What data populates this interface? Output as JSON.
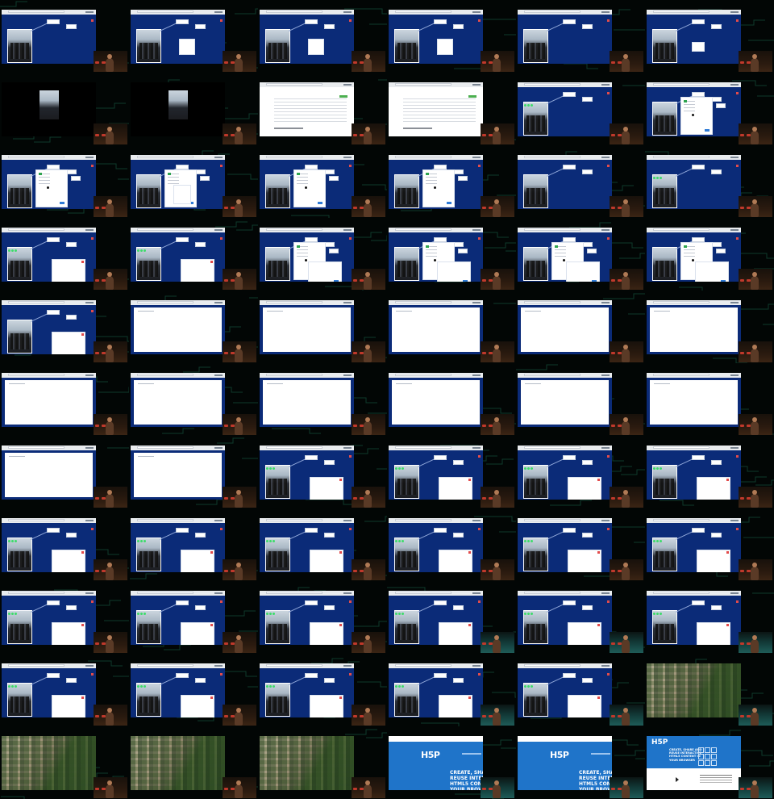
{
  "grid": {
    "title": "",
    "rows": [
      [
        "editor-label",
        "editor-label-popup",
        "editor-label-popup",
        "editor-label-popup",
        "editor-labels",
        "editor-labels-buttons"
      ],
      [
        "black-preview",
        "black-preview",
        "white-list",
        "white-list",
        "editor-greens",
        "editor-dialog"
      ],
      [
        "editor-dialog",
        "editor-dialog-list",
        "editor-dialog",
        "editor-dialog",
        "editor-labels",
        "editor-greens"
      ],
      [
        "editor-greens-big",
        "editor-greens-big",
        "editor-dialog-overlap",
        "editor-dialog-overlap",
        "editor-dialog-overlap",
        "editor-dialog-overlap"
      ],
      [
        "editor-big",
        "blank-white",
        "blank-white",
        "blank-white",
        "blank-white",
        "blank-white"
      ],
      [
        "blank-white",
        "blank-white",
        "blank-white",
        "blank-white",
        "blank-white",
        "blank-white"
      ],
      [
        "blank-white",
        "blank-white",
        "editor-greens-big",
        "editor-greens-big",
        "editor-greens-big",
        "editor-greens-big"
      ],
      [
        "editor-greens-big",
        "editor-greens-big",
        "editor-greens-big",
        "editor-greens-big",
        "editor-greens-big",
        "editor-greens-big"
      ],
      [
        "editor-greens-big",
        "editor-greens-big",
        "editor-greens-big",
        "editor-greens-big",
        "editor-greens-big",
        "editor-greens-big"
      ],
      [
        "editor-greens-big",
        "editor-greens-big",
        "editor-greens-big",
        "editor-greens-big",
        "editor-greens-big",
        "aerial-map"
      ],
      [
        "aerial-map",
        "aerial-map",
        "aerial-map",
        "h5p-hero",
        "h5p-hero",
        "h5p-home"
      ]
    ]
  },
  "h5p": {
    "logo_text": "H5P",
    "hero_text_lines": [
      "CREATE, SHARE AND",
      "REUSE INTERACTIVE",
      "HTML5 CONTENT IN",
      "YOUR BROWSER"
    ]
  },
  "colors": {
    "editor_blue": "#0b2b78",
    "h5p_blue": "#1f74c9",
    "circuit_green": "#0e3a2c",
    "accent_green": "#3ddc6a",
    "close_red": "#e24b4b"
  }
}
